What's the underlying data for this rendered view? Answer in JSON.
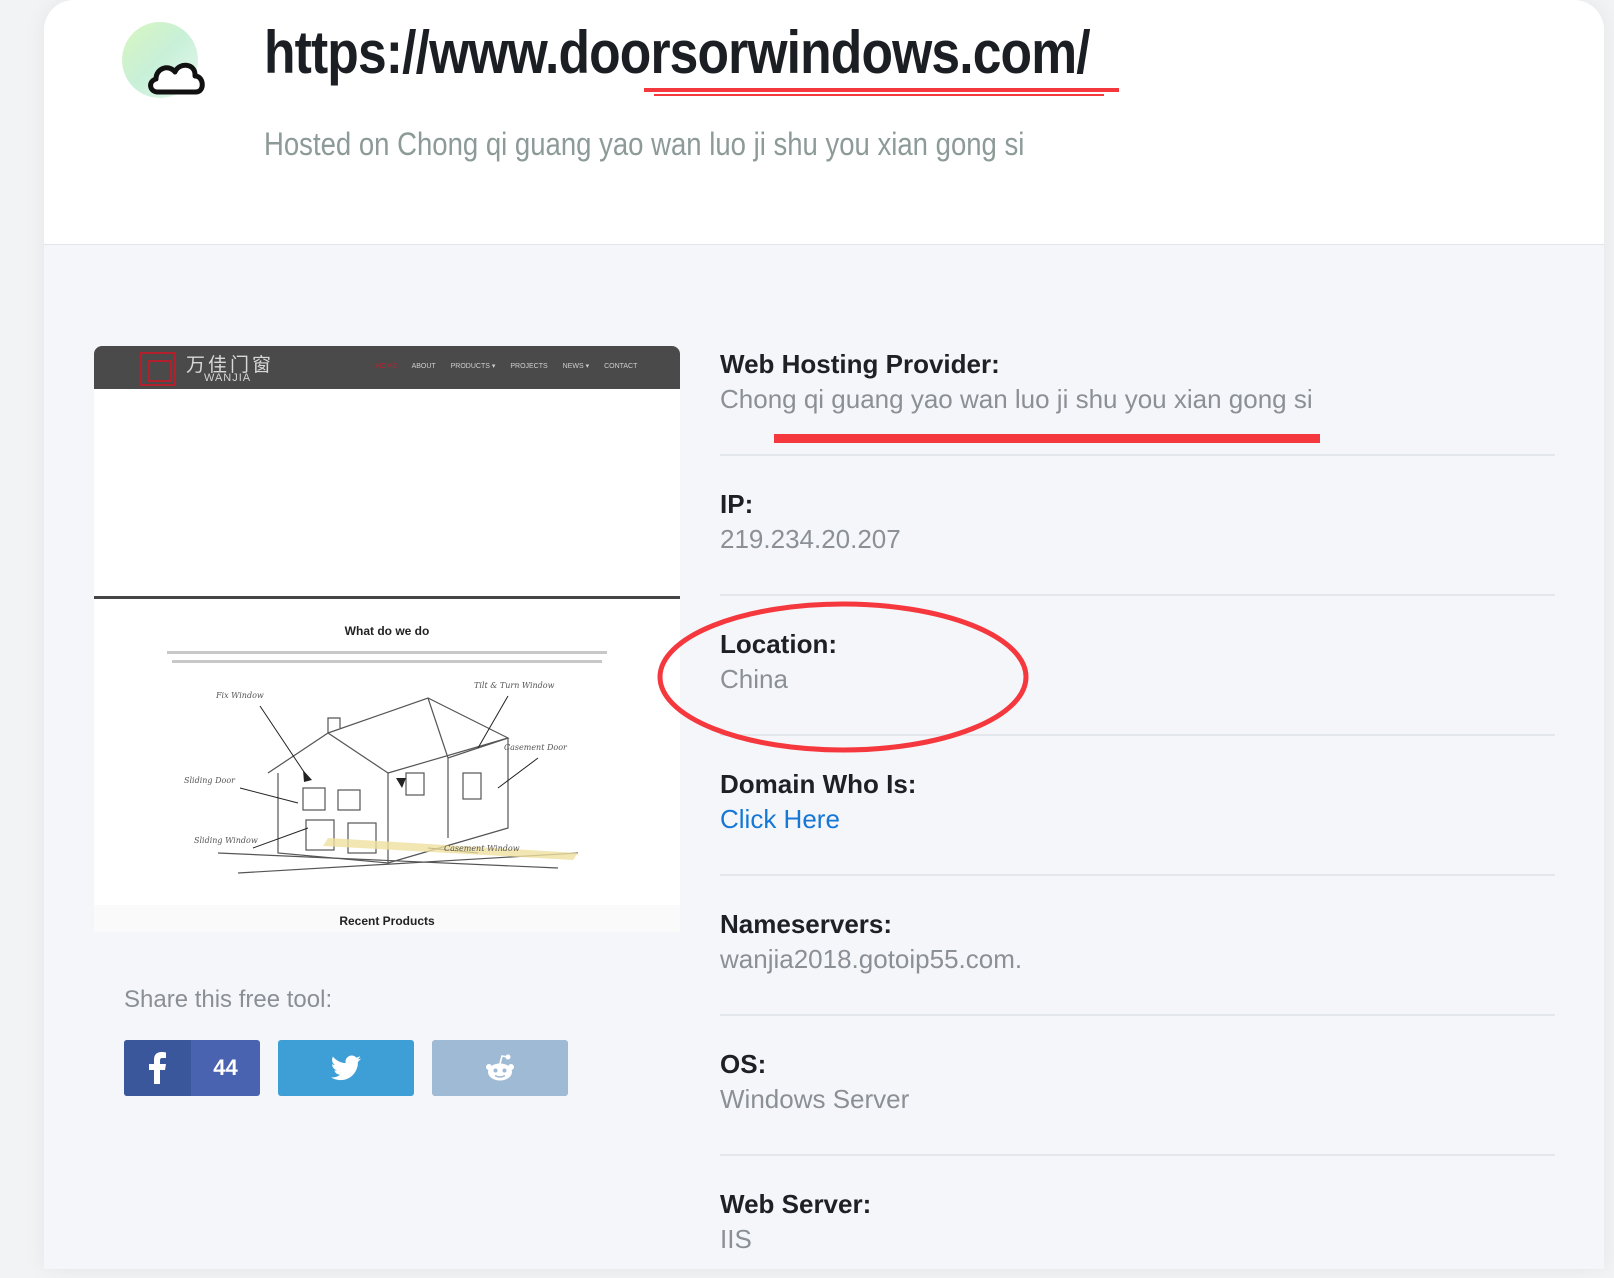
{
  "header": {
    "url": "https://www.doorsorwindows.com/",
    "hosted_on": "Hosted on Chong qi guang yao wan luo ji shu you xian gong si",
    "logo_icon": "cloud-icon"
  },
  "preview": {
    "brand_cn": "万佳门窗",
    "brand": "WANJIA",
    "nav": [
      "HOME",
      "ABOUT",
      "PRODUCTS ▾",
      "PROJECTS",
      "NEWS ▾",
      "CONTACT"
    ],
    "section_title": "What do we do",
    "labels": [
      "Fix Window",
      "Tilt & Turn Window",
      "Casement Door",
      "Sliding Door",
      "Sliding Window",
      "Casement Window"
    ],
    "recent": "Recent Products"
  },
  "share": {
    "label": "Share this free tool:",
    "facebook_count": "44",
    "icons": [
      "facebook-icon",
      "twitter-icon",
      "reddit-icon"
    ],
    "colors": {
      "facebook": "#3b579c",
      "facebook_count": "#4a63b0",
      "twitter": "#3d9fd6",
      "reddit": "#9fbad4"
    }
  },
  "info": [
    {
      "label": "Web Hosting Provider:",
      "value": "Chong qi guang yao wan luo ji shu you xian gong si"
    },
    {
      "label": "IP:",
      "value": "219.234.20.207"
    },
    {
      "label": "Location:",
      "value": "China"
    },
    {
      "label": "Domain Who Is:",
      "value": "Click Here"
    },
    {
      "label": "Nameservers:",
      "value": "wanjia2018.gotoip55.com."
    },
    {
      "label": "OS:",
      "value": "Windows Server"
    },
    {
      "label": "Web Server:",
      "value": "IIS"
    }
  ],
  "annotations": {
    "color": "#f5383e"
  }
}
